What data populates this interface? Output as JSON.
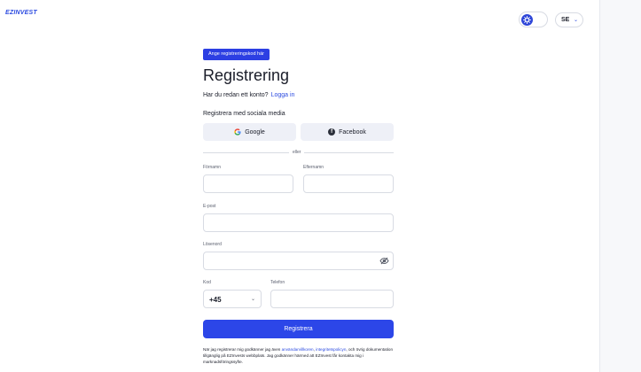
{
  "brand": {
    "logo_text": "EZINVEST"
  },
  "header": {
    "theme_toggle_icon": "settings-icon",
    "language": "SE",
    "language_chevron_icon": "chevron-down-icon"
  },
  "form": {
    "badge": "Ange registreringskod här",
    "title": "Registrering",
    "login_prompt": "Har du redan ett konto?",
    "login_link": "Logga in",
    "social_heading": "Registrera med sociala media",
    "google_label": "Google",
    "facebook_label": "Facebook",
    "divider_label": "eller",
    "firstname_label": "Förnamn",
    "lastname_label": "Efternamn",
    "email_label": "E-post",
    "password_label": "Lösenord",
    "code_label": "Kod",
    "code_value": "+45",
    "phone_label": "Telefon",
    "submit_label": "Registrera",
    "terms_prefix": "När jag registrerar mig godkänner jag även ",
    "terms_link1": "användarvillkoren",
    "terms_sep": ", ",
    "terms_link2": "integritetspolicyn",
    "terms_rest": ", och övrig dokumentation tillgänglig på EZInvests webbplats. Jag godkänner härmed att EZInvest får kontakta mig i marknadsföringssyfte."
  },
  "colors": {
    "accent": "#2c46e8",
    "text": "#1a1d29",
    "muted": "#5a5f6e"
  }
}
